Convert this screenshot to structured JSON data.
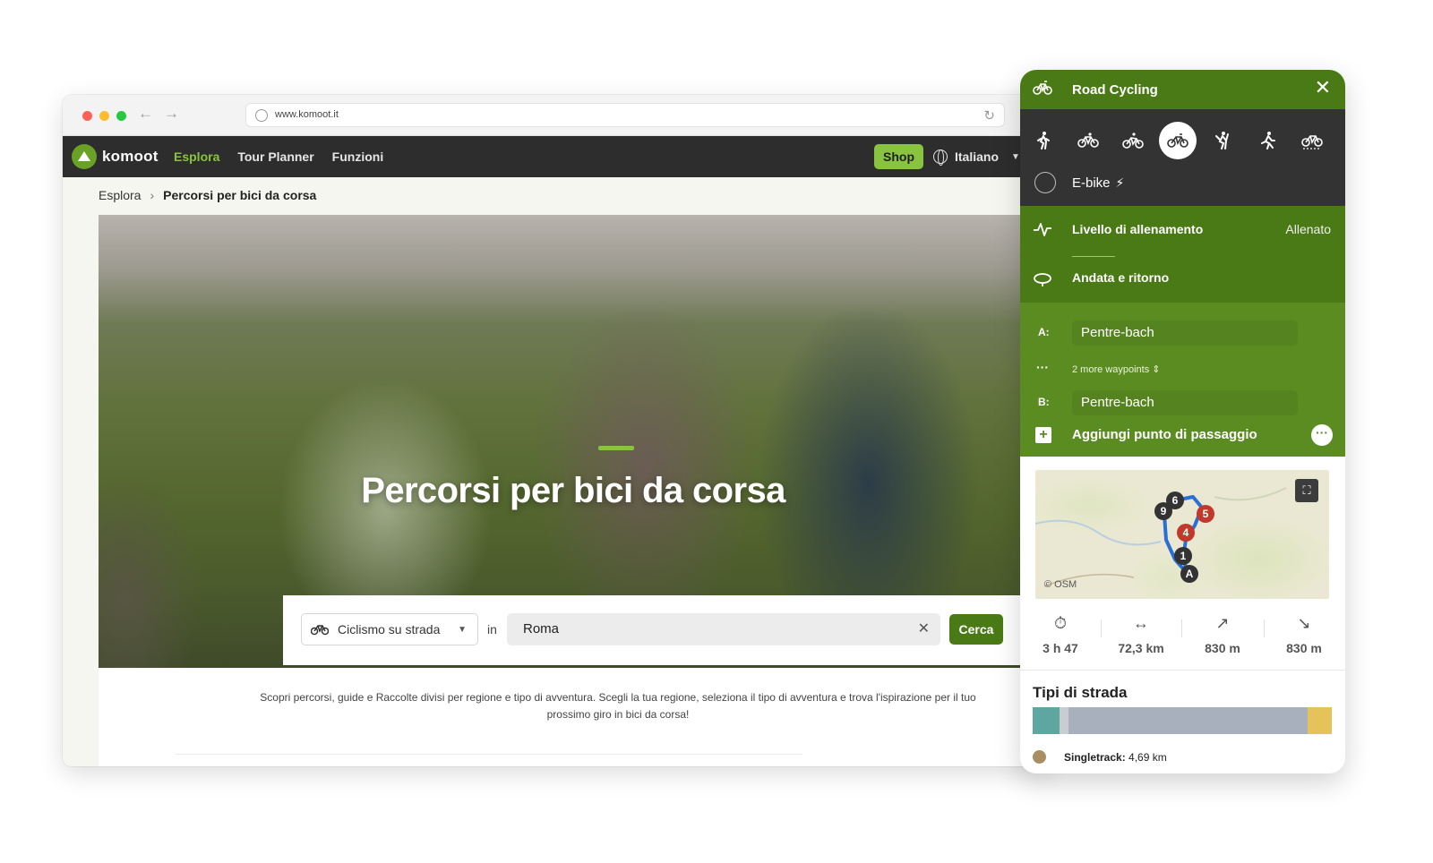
{
  "browser": {
    "url": "www.komoot.it",
    "nav": {
      "logo": "komoot",
      "links": [
        {
          "label": "Esplora"
        },
        {
          "label": "Tour Planner"
        },
        {
          "label": "Funzioni"
        }
      ],
      "shop": "Shop",
      "language": "Italiano"
    },
    "breadcrumb": {
      "root": "Esplora",
      "current": "Percorsi per bici da corsa"
    },
    "hero": {
      "title": "Percorsi per bici da corsa"
    },
    "search": {
      "sport": "Ciclismo su strada",
      "in": "in",
      "location": "Roma",
      "button": "Cerca"
    },
    "description": "Scopri percorsi, guide e Raccolte divisi per regione e tipo di avventura. Scegli la tua regione, seleziona il tipo di avventura e trova l'ispirazione per il tuo prossimo giro in bici da corsa!"
  },
  "planner": {
    "title": "Road Cycling",
    "sports": [
      "hiking-icon",
      "bike-touring-icon",
      "mtb-icon",
      "road-cycling-icon",
      "mountaineering-icon",
      "running-icon",
      "gravel-icon"
    ],
    "selected_sport_index": 3,
    "ebike": "E-bike",
    "fitness": {
      "label": "Livello di allenamento",
      "value": "Allenato"
    },
    "roundtrip": "Andata e ritorno",
    "waypoints": {
      "a_label": "A:",
      "a_value": "Pentre-bach",
      "more": "2 more waypoints",
      "b_label": "B:",
      "b_value": "Pentre-bach"
    },
    "add_waypoint": "Aggiungi punto di passaggio",
    "map": {
      "attribution": "© OSM",
      "markers": [
        "6",
        "9",
        "5",
        "4",
        "1",
        "A"
      ]
    },
    "stats": {
      "duration": "3 h 47",
      "distance": "72,3 km",
      "uphill": "830 m",
      "downhill": "830 m"
    },
    "road_types": {
      "title": "Tipi di strada",
      "segments": [
        {
          "color": "#5da7a0",
          "fraction": 0.09
        },
        {
          "color": "#c9ccd1",
          "fraction": 0.03
        },
        {
          "color": "#a8b0bd",
          "fraction": 0.8
        },
        {
          "color": "#e6c25a",
          "fraction": 0.08
        }
      ],
      "legend": [
        {
          "label": "Singletrack:",
          "value": "4,69 km",
          "color": "#a88f63"
        }
      ]
    }
  }
}
